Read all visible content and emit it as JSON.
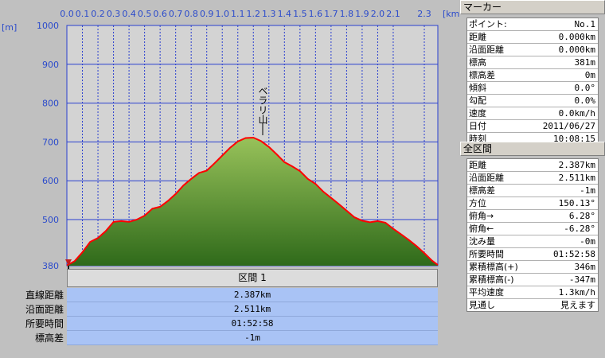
{
  "chart_data": {
    "type": "area",
    "xlabel_unit": "[km]",
    "ylabel_unit": "[m]",
    "x_ticks": [
      "0.0",
      "0.1",
      "0.2",
      "0.3",
      "0.4",
      "0.5",
      "0.6",
      "0.7",
      "0.8",
      "0.9",
      "1.0",
      "1.1",
      "1.2",
      "1.3",
      "1.4",
      "1.5",
      "1.6",
      "1.7",
      "1.8",
      "1.9",
      "2.0",
      "2.1",
      "2.3"
    ],
    "y_ticks": [
      "1000",
      "900",
      "800",
      "700",
      "600",
      "500",
      "380"
    ],
    "xlim": [
      0,
      2.387
    ],
    "ylim": [
      380,
      1000
    ],
    "grid": true,
    "annotation": "ベラリ山",
    "series": [
      {
        "x": [
          0.0,
          0.05,
          0.1,
          0.15,
          0.2,
          0.25,
          0.3,
          0.35,
          0.4,
          0.45,
          0.5,
          0.55,
          0.6,
          0.65,
          0.7,
          0.75,
          0.8,
          0.85,
          0.9,
          0.95,
          1.0,
          1.05,
          1.1,
          1.15,
          1.2,
          1.25,
          1.3,
          1.35,
          1.4,
          1.45,
          1.5,
          1.55,
          1.6,
          1.65,
          1.7,
          1.75,
          1.8,
          1.85,
          1.9,
          1.95,
          2.0,
          2.05,
          2.1,
          2.15,
          2.2,
          2.25,
          2.3,
          2.35,
          2.387
        ],
        "y": [
          381,
          392,
          415,
          442,
          452,
          470,
          494,
          496,
          494,
          500,
          510,
          528,
          533,
          548,
          566,
          588,
          605,
          620,
          626,
          645,
          665,
          685,
          701,
          710,
          711,
          702,
          687,
          668,
          648,
          637,
          625,
          605,
          592,
          572,
          556,
          540,
          523,
          506,
          497,
          493,
          496,
          492,
          476,
          462,
          447,
          431,
          413,
          393,
          382
        ]
      }
    ]
  },
  "section": {
    "header": "区間 1",
    "rows": [
      {
        "label": "直線距離",
        "value": "2.387km"
      },
      {
        "label": "沿面距離",
        "value": "2.511km"
      },
      {
        "label": "所要時間",
        "value": "01:52:58"
      },
      {
        "label": "標高差",
        "value": "-1m"
      }
    ]
  },
  "marker_panel": {
    "title": "マーカー",
    "items": [
      {
        "label": "ポイント:",
        "value": "No.1"
      },
      {
        "label": "距離",
        "value": "0.000km"
      },
      {
        "label": "沿面距離",
        "value": "0.000km"
      },
      {
        "label": "標高",
        "value": "381m"
      },
      {
        "label": "標高差",
        "value": "0m"
      },
      {
        "label": "傾斜",
        "value": "0.0°"
      },
      {
        "label": "勾配",
        "value": "0.0%"
      },
      {
        "label": "速度",
        "value": "0.0km/h"
      },
      {
        "label": "日付",
        "value": "2011/06/27"
      },
      {
        "label": "時刻",
        "value": "10:08:15"
      }
    ]
  },
  "all_section_panel": {
    "title": "全区間",
    "items": [
      {
        "label": "距離",
        "value": "2.387km"
      },
      {
        "label": "沿面距離",
        "value": "2.511km"
      },
      {
        "label": "標高差",
        "value": "-1m"
      },
      {
        "label": "方位",
        "value": "150.13°"
      },
      {
        "label": "俯角→",
        "value": "6.28°"
      },
      {
        "label": "俯角←",
        "value": "-6.28°"
      },
      {
        "label": "沈み量",
        "value": "-0m"
      },
      {
        "label": "所要時間",
        "value": "01:52:58"
      },
      {
        "label": "累積標高(+)",
        "value": "346m"
      },
      {
        "label": "累積標高(-)",
        "value": "-347m"
      },
      {
        "label": "平均速度",
        "value": "1.3km/h"
      },
      {
        "label": "見通し",
        "value": "見えます"
      }
    ]
  },
  "colors": {
    "profile_line": "#ff0000",
    "fill_top": "#8fb84a",
    "fill_bottom": "#2f6a1a",
    "plot_bg": "#d3d3d3",
    "grid": "#2a3fd0",
    "tick_text": "#2a4acb"
  }
}
